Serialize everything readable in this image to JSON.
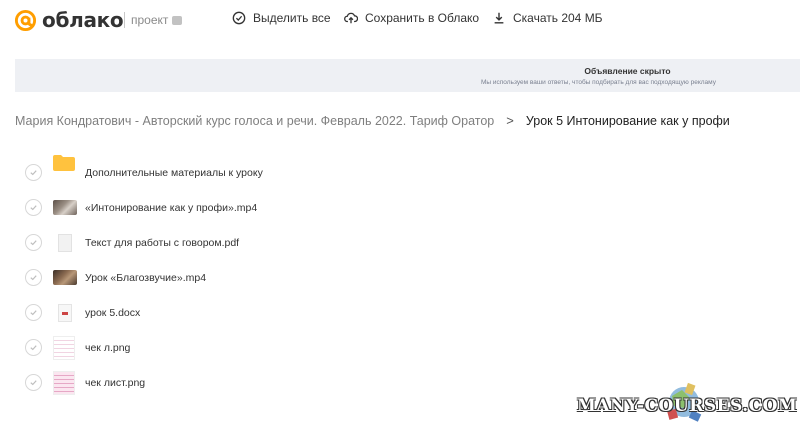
{
  "header": {
    "logo_text": "облако",
    "project_label": "проект",
    "actions": {
      "select_all": "Выделить все",
      "save_to_cloud": "Сохранить в Облако",
      "download": "Скачать 204 МБ"
    }
  },
  "ad": {
    "title": "Объявление скрыто",
    "subtitle": "Мы используем ваши ответы, чтобы подбирать для вас подходящую рекламу"
  },
  "breadcrumb": {
    "parent": "Мария Кондратович - Авторский курс голоса и речи. Февраль 2022. Тариф Оратор",
    "separator": ">",
    "current": "Урок 5 Интонирование как у профи"
  },
  "files": [
    {
      "name": "Дополнительные материалы к уроку",
      "kind": "folder"
    },
    {
      "name": "«Интонирование как у профи».mp4",
      "kind": "video"
    },
    {
      "name": "Текст для работы с говором.pdf",
      "kind": "pdf"
    },
    {
      "name": "Урок «Благозвучие».mp4",
      "kind": "video"
    },
    {
      "name": "урок 5.docx",
      "kind": "docx"
    },
    {
      "name": "чек л.png",
      "kind": "image"
    },
    {
      "name": "чек лист.png",
      "kind": "image"
    }
  ],
  "watermark": "MANY-COURSES.COM",
  "colors": {
    "brand": "#ff9e00",
    "folder": "#ffc23e",
    "ad_background": "#eef0f4"
  }
}
